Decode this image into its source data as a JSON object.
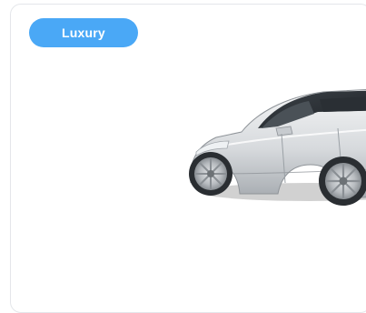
{
  "card": {
    "badge_label": "Luxury",
    "image_icon": "car-icon",
    "colors": {
      "badge_bg": "#4aa8f6",
      "card_border": "#e4e6ea"
    }
  }
}
